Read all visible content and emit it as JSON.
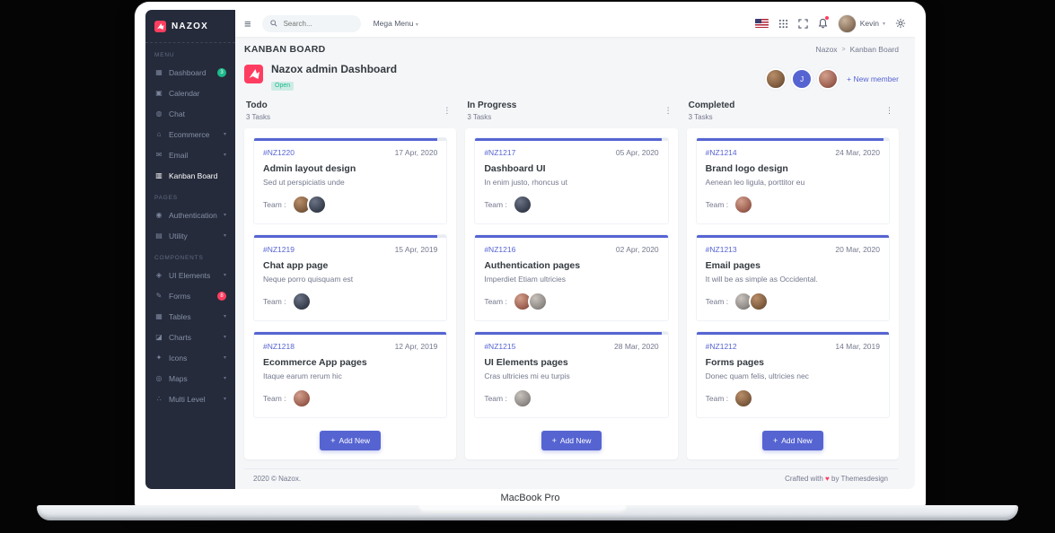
{
  "device": {
    "label": "MacBook Pro"
  },
  "colors": {
    "primary": "#5664d2",
    "success": "#1cbb8c",
    "danger": "#ff3d60",
    "sidebar_bg": "#252b3b"
  },
  "icon_glyphs": {
    "hamburger-icon": "≡",
    "chevron-down-icon": "▾",
    "dots-icon": "⋮",
    "plus-icon": "+",
    "breadcrumb-separator": ">",
    "dashboard-icon": "▦",
    "calendar-icon": "▣",
    "chat-icon": "◍",
    "ecommerce-icon": "⌂",
    "email-icon": "✉",
    "kanban-icon": "▥",
    "authentication-icon": "◉",
    "utility-icon": "▤",
    "ui-elements-icon": "◈",
    "forms-icon": "✎",
    "tables-icon": "▦",
    "charts-icon": "◪",
    "icons-icon": "✦",
    "maps-icon": "◎",
    "multi-level-icon": "∴"
  },
  "sidebar": {
    "brand": "NAZOX",
    "sections": [
      {
        "label": "MENU",
        "items": [
          {
            "label": "Dashboard",
            "icon": "dashboard-icon",
            "badge": "3",
            "badge_color": "#1cbb8c"
          },
          {
            "label": "Calendar",
            "icon": "calendar-icon"
          },
          {
            "label": "Chat",
            "icon": "chat-icon"
          },
          {
            "label": "Ecommerce",
            "icon": "ecommerce-icon",
            "chevron": true
          },
          {
            "label": "Email",
            "icon": "email-icon",
            "chevron": true
          },
          {
            "label": "Kanban Board",
            "icon": "kanban-icon",
            "active": true
          }
        ]
      },
      {
        "label": "PAGES",
        "items": [
          {
            "label": "Authentication",
            "icon": "authentication-icon",
            "chevron": true
          },
          {
            "label": "Utility",
            "icon": "utility-icon",
            "chevron": true
          }
        ]
      },
      {
        "label": "COMPONENTS",
        "items": [
          {
            "label": "UI Elements",
            "icon": "ui-elements-icon",
            "chevron": true
          },
          {
            "label": "Forms",
            "icon": "forms-icon",
            "badge": "8",
            "badge_color": "#ff3d60"
          },
          {
            "label": "Tables",
            "icon": "tables-icon",
            "chevron": true
          },
          {
            "label": "Charts",
            "icon": "charts-icon",
            "chevron": true
          },
          {
            "label": "Icons",
            "icon": "icons-icon",
            "chevron": true
          },
          {
            "label": "Maps",
            "icon": "maps-icon",
            "chevron": true
          },
          {
            "label": "Multi Level",
            "icon": "multi-level-icon",
            "chevron": true
          }
        ]
      }
    ]
  },
  "topbar": {
    "search_placeholder": "Search...",
    "mega_menu_label": "Mega Menu",
    "user_name": "Kevin"
  },
  "page": {
    "title": "KANBAN BOARD",
    "breadcrumb": [
      "Nazox",
      "Kanban Board"
    ]
  },
  "board": {
    "title": "Nazox admin Dashboard",
    "status": "Open",
    "new_member_label": "New member",
    "team_label": "Team :",
    "members": [
      {
        "type": "photo"
      },
      {
        "type": "initial",
        "label": "J"
      },
      {
        "type": "photo"
      }
    ],
    "columns": [
      {
        "name": "Todo",
        "count": "3 Tasks",
        "add_label": "Add New",
        "cards": [
          {
            "ref": "#NZ1220",
            "date": "17 Apr, 2020",
            "title": "Admin layout design",
            "desc": "Sed ut perspiciatis unde",
            "team": 2,
            "progress": 95
          },
          {
            "ref": "#NZ1219",
            "date": "15 Apr, 2019",
            "title": "Chat app page",
            "desc": "Neque porro quisquam est",
            "team": 1,
            "progress": 95
          },
          {
            "ref": "#NZ1218",
            "date": "12 Apr, 2019",
            "title": "Ecommerce App pages",
            "desc": "Itaque earum rerum hic",
            "team": 1,
            "progress": 100
          }
        ]
      },
      {
        "name": "In Progress",
        "count": "3 Tasks",
        "add_label": "Add New",
        "cards": [
          {
            "ref": "#NZ1217",
            "date": "05 Apr, 2020",
            "title": "Dashboard UI",
            "desc": "In enim justo, rhoncus ut",
            "team": 1,
            "progress": 97
          },
          {
            "ref": "#NZ1216",
            "date": "02 Apr, 2020",
            "title": "Authentication pages",
            "desc": "Imperdiet Etiam ultricies",
            "team": 2,
            "progress": 100
          },
          {
            "ref": "#NZ1215",
            "date": "28 Mar, 2020",
            "title": "UI Elements pages",
            "desc": "Cras ultricies mi eu turpis",
            "team": 1,
            "progress": 97
          }
        ]
      },
      {
        "name": "Completed",
        "count": "3 Tasks",
        "add_label": "Add New",
        "cards": [
          {
            "ref": "#NZ1214",
            "date": "24 Mar, 2020",
            "title": "Brand logo design",
            "desc": "Aenean leo ligula, porttitor eu",
            "team": 1,
            "progress": 97
          },
          {
            "ref": "#NZ1213",
            "date": "20 Mar, 2020",
            "title": "Email pages",
            "desc": "It will be as simple as Occidental.",
            "team": 2,
            "progress": 100
          },
          {
            "ref": "#NZ1212",
            "date": "14 Mar, 2019",
            "title": "Forms pages",
            "desc": "Donec quam felis, ultricies nec",
            "team": 1,
            "progress": 100
          }
        ]
      }
    ]
  },
  "footer": {
    "left": "2020 © Nazox.",
    "right_prefix": "Crafted with",
    "heart": "♥",
    "right_suffix": "by Themesdesign"
  }
}
